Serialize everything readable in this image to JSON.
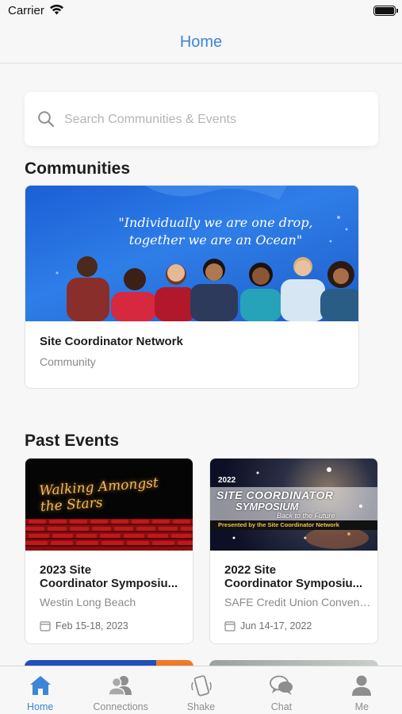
{
  "status_bar": {
    "carrier": "Carrier"
  },
  "nav": {
    "title": "Home"
  },
  "search": {
    "placeholder": "Search Communities & Events",
    "value": ""
  },
  "communities": {
    "heading": "Communities",
    "items": [
      {
        "title": "Site Coordinator Network",
        "subtitle": "Community",
        "banner_quote_line1": "\"Individually we are one drop,",
        "banner_quote_line2": "together we are an Ocean\""
      }
    ]
  },
  "past_events": {
    "heading": "Past Events",
    "items": [
      {
        "title_line1": "2023 Site",
        "title_line2": "Coordinator Symposiu...",
        "venue": "Westin Long Beach",
        "date": "Feb 15-18, 2023",
        "image_text": "Walking Amongst the Stars"
      },
      {
        "title_line1": "2022 Site",
        "title_line2": "Coordinator Symposiu...",
        "venue": "SAFE Credit Union Convent...",
        "date": "Jun 14-17, 2022",
        "image_year": "2022",
        "image_line1": "SITE COORDINATOR",
        "image_line2": "SYMPOSIUM",
        "image_line3": "Back to the Future",
        "image_footer": "Presented by the Site Coordinator Network"
      }
    ]
  },
  "tabs": [
    {
      "label": "Home",
      "icon": "home-icon",
      "active": true
    },
    {
      "label": "Connections",
      "icon": "people-icon",
      "active": false
    },
    {
      "label": "Shake",
      "icon": "phone-shake-icon",
      "active": false
    },
    {
      "label": "Chat",
      "icon": "chat-bubbles-icon",
      "active": false
    },
    {
      "label": "Me",
      "icon": "person-icon",
      "active": false
    }
  ],
  "colors": {
    "accent": "#3d86d6",
    "tab_inactive": "#8e8e8e",
    "background": "#f7f7f8"
  }
}
